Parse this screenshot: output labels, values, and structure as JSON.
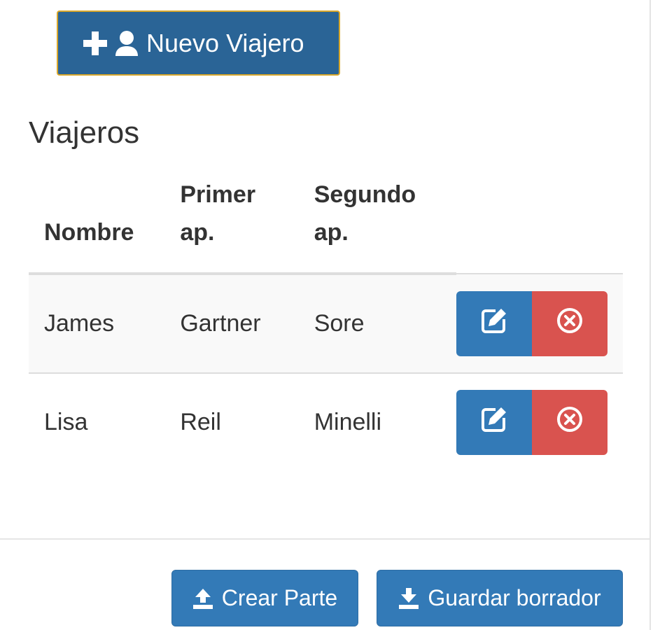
{
  "new_traveler_button": {
    "label": "Nuevo Viajero",
    "icons": [
      "plus-icon",
      "user-icon"
    ]
  },
  "section": {
    "title": "Viajeros"
  },
  "table": {
    "headers": {
      "nombre": "Nombre",
      "primer_line1": "Primer",
      "primer_line2": "ap.",
      "segundo_line1": "Segundo",
      "segundo_line2": "ap."
    },
    "rows": [
      {
        "nombre": "James",
        "primer_ap": "Gartner",
        "segundo_ap": "Sore"
      },
      {
        "nombre": "Lisa",
        "primer_ap": "Reil",
        "segundo_ap": "Minelli"
      }
    ],
    "row_actions": [
      "edit-icon",
      "delete-circle-icon"
    ]
  },
  "footer": {
    "crear_label": "Crear Parte",
    "guardar_label": "Guardar borrador"
  },
  "colors": {
    "primary": "#337ab7",
    "primary_dark": "#2a6496",
    "danger": "#d9534f",
    "focus_outline": "#d9a72a",
    "text": "#333333",
    "stripe": "#f9f9f9"
  }
}
